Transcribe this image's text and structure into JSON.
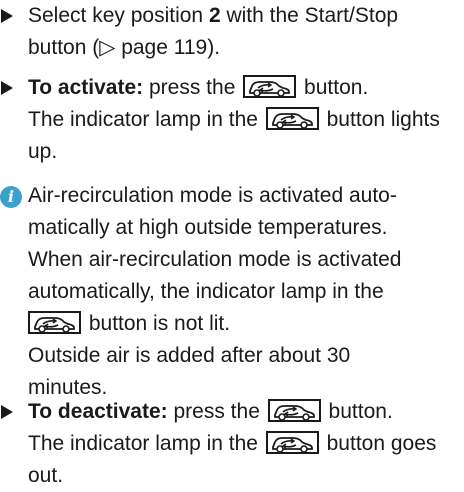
{
  "step1": {
    "line1_pre": "Select key position ",
    "line1_bold": "2",
    "line1_post": " with the Start/Stop",
    "line2": "button (▷ page 119)."
  },
  "step2": {
    "bold": "To activate:",
    "line1_pre": " press the ",
    "line1_post": " button.",
    "line2_pre": "The indicator lamp in the ",
    "line2_post": " button lights",
    "line3": "up."
  },
  "note": {
    "icon": "info-icon",
    "line1": "Air-recirculation mode is activated auto-",
    "line2": "matically at high outside temperatures.",
    "line3": "When air-recirculation mode is activated",
    "line4": "automatically, the indicator lamp in the",
    "line5_post": " button is not lit.",
    "line6": "Outside air is added after about 30",
    "line7": "minutes."
  },
  "step3": {
    "bold": "To deactivate:",
    "line1_pre": " press the ",
    "line1_post": " button.",
    "line2_pre": "The indicator lamp in the ",
    "line2_post": " button goes",
    "line3": "out."
  },
  "button_icon": "air-recirculation-button-icon",
  "colors": {
    "text": "#1a1a1a",
    "info": "#3aa0ce"
  }
}
